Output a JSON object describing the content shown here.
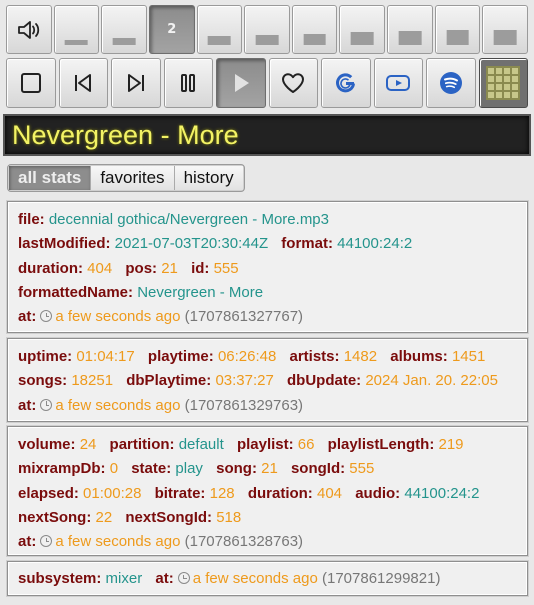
{
  "volume": {
    "levels": [
      {
        "label": "",
        "bar": 0.2
      },
      {
        "label": "",
        "bar": 0.3
      },
      {
        "label": "2",
        "bar": 0.4,
        "active": true
      },
      {
        "label": "",
        "bar": 0.5
      },
      {
        "label": "",
        "bar": 0.6
      },
      {
        "label": "",
        "bar": 0.7
      },
      {
        "label": "",
        "bar": 0.8
      },
      {
        "label": "",
        "bar": 0.9
      },
      {
        "label": "",
        "bar": 1.0
      },
      {
        "label": "",
        "bar": 1.0
      }
    ]
  },
  "controls": {
    "stop": "stop-icon",
    "previous": "skip-previous-icon",
    "next": "skip-next-icon",
    "pause": "pause-icon",
    "play": "play-icon",
    "favorite": "heart-icon",
    "google": "google-icon",
    "youtube": "youtube-icon",
    "spotify": "spotify-icon",
    "grid": "grid-icon"
  },
  "now_playing": {
    "title": "Nevergreen - More"
  },
  "tabs": [
    {
      "label": "all stats",
      "active": true
    },
    {
      "label": "favorites"
    },
    {
      "label": "history"
    }
  ],
  "song_panel": {
    "file_key": "file:",
    "file": "decennial gothica/Nevergreen - More.mp3",
    "lastModified_key": "lastModified:",
    "lastModified": "2021-07-03T20:30:44Z",
    "format_key": "format:",
    "format": "44100:24:2",
    "duration_key": "duration:",
    "duration": "404",
    "pos_key": "pos:",
    "pos": "21",
    "id_key": "id:",
    "id": "555",
    "formattedName_key": "formattedName:",
    "formattedName": "Nevergreen - More",
    "at_key": "at:",
    "at_relative": "a few seconds ago",
    "at_raw": "(1707861327767)"
  },
  "stats_panel": {
    "uptime_key": "uptime:",
    "uptime": "01:04:17",
    "playtime_key": "playtime:",
    "playtime": "06:26:48",
    "artists_key": "artists:",
    "artists": "1482",
    "albums_key": "albums:",
    "albums": "1451",
    "songs_key": "songs:",
    "songs": "18251",
    "dbPlaytime_key": "dbPlaytime:",
    "dbPlaytime": "03:37:27",
    "dbUpdate_key": "dbUpdate:",
    "dbUpdate": "2024 Jan. 20. 22:05",
    "at_key": "at:",
    "at_relative": "a few seconds ago",
    "at_raw": "(1707861329763)"
  },
  "status_panel": {
    "volume_key": "volume:",
    "volume": "24",
    "partition_key": "partition:",
    "partition": "default",
    "playlist_key": "playlist:",
    "playlist": "66",
    "playlistLength_key": "playlistLength:",
    "playlistLength": "219",
    "mixrampDb_key": "mixrampDb:",
    "mixrampDb": "0",
    "state_key": "state:",
    "state": "play",
    "song_key": "song:",
    "song": "21",
    "songId_key": "songId:",
    "songId": "555",
    "elapsed_key": "elapsed:",
    "elapsed": "01:00:28",
    "bitrate_key": "bitrate:",
    "bitrate": "128",
    "duration_key": "duration:",
    "duration": "404",
    "audio_key": "audio:",
    "audio": "44100:24:2",
    "nextSong_key": "nextSong:",
    "nextSong": "22",
    "nextSongId_key": "nextSongId:",
    "nextSongId": "518",
    "at_key": "at:",
    "at_relative": "a few seconds ago",
    "at_raw": "(1707861328763)"
  },
  "subsystem_panel": {
    "subsystem_key": "subsystem:",
    "subsystem": "mixer",
    "at_key": "at:",
    "at_relative": "a few seconds ago",
    "at_raw": "(1707861299821)"
  },
  "colors": {
    "key": "#7a0c0c",
    "value_teal": "#24948c",
    "value_orange": "#ee9a1c",
    "title_yellow": "#f3f365"
  }
}
